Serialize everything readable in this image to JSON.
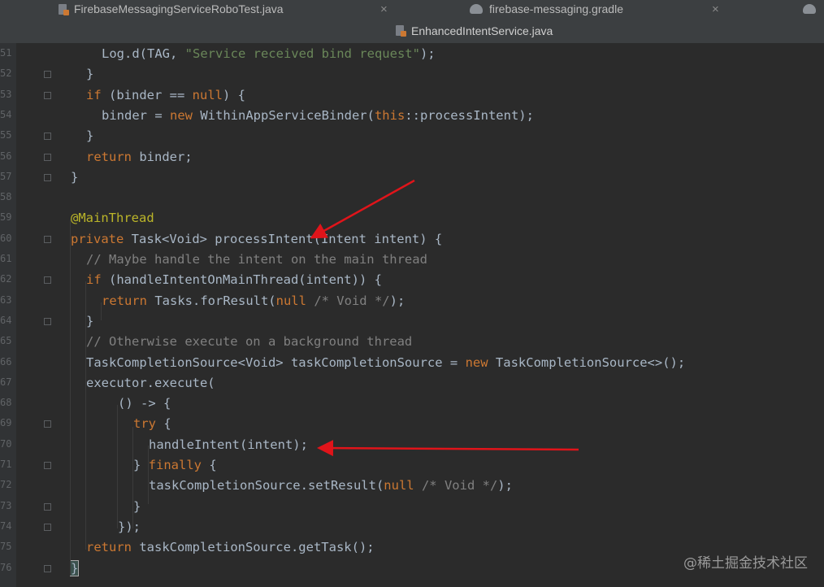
{
  "tabs_row1": [
    {
      "label": "FirebaseMessagingServiceRoboTest.java",
      "icon": "java-file-icon"
    },
    {
      "label": "firebase-messaging.gradle",
      "icon": "gradle-elephant-icon"
    }
  ],
  "active_tab": {
    "label": "EnhancedIntentService.java",
    "icon": "java-file-icon"
  },
  "line_numbers": [
    "51",
    "52",
    "53",
    "54",
    "55",
    "56",
    "57",
    "58",
    "59",
    "60",
    "61",
    "62",
    "63",
    "64",
    "65",
    "66",
    "67",
    "68",
    "69",
    "70",
    "71",
    "72",
    "73",
    "74",
    "75",
    "76"
  ],
  "code_lines": [
    {
      "indent": 125,
      "segments": [
        {
          "t": "Log.d(TAG, ",
          "c": ""
        },
        {
          "t": "\"Service received bind request\"",
          "c": "str"
        },
        {
          "t": ");",
          "c": ""
        }
      ]
    },
    {
      "indent": 106,
      "segments": [
        {
          "t": "}",
          "c": ""
        }
      ]
    },
    {
      "indent": 106,
      "segments": [
        {
          "t": "if",
          "c": "kw"
        },
        {
          "t": " (binder == ",
          "c": ""
        },
        {
          "t": "null",
          "c": "kw"
        },
        {
          "t": ") {",
          "c": ""
        }
      ]
    },
    {
      "indent": 125,
      "segments": [
        {
          "t": "binder = ",
          "c": ""
        },
        {
          "t": "new",
          "c": "kw"
        },
        {
          "t": " WithinAppServiceBinder(",
          "c": ""
        },
        {
          "t": "this",
          "c": "kw"
        },
        {
          "t": "::processIntent);",
          "c": ""
        }
      ]
    },
    {
      "indent": 106,
      "segments": [
        {
          "t": "}",
          "c": ""
        }
      ]
    },
    {
      "indent": 106,
      "segments": [
        {
          "t": "return",
          "c": "kw"
        },
        {
          "t": " binder;",
          "c": ""
        }
      ]
    },
    {
      "indent": 87,
      "segments": [
        {
          "t": "}",
          "c": ""
        }
      ]
    },
    {
      "indent": 87,
      "segments": []
    },
    {
      "indent": 87,
      "segments": [
        {
          "t": "@MainThread",
          "c": "ann"
        }
      ]
    },
    {
      "indent": 87,
      "segments": [
        {
          "t": "private",
          "c": "kw"
        },
        {
          "t": " Task<Void> processIntent(Intent intent) {",
          "c": ""
        }
      ]
    },
    {
      "indent": 106,
      "segments": [
        {
          "t": "// Maybe handle the intent on the main thread",
          "c": "cm"
        }
      ]
    },
    {
      "indent": 106,
      "segments": [
        {
          "t": "if",
          "c": "kw"
        },
        {
          "t": " (handleIntentOnMainThread(intent)) {",
          "c": ""
        }
      ]
    },
    {
      "indent": 125,
      "segments": [
        {
          "t": "return",
          "c": "kw"
        },
        {
          "t": " Tasks.forResult(",
          "c": ""
        },
        {
          "t": "null",
          "c": "kw"
        },
        {
          "t": " ",
          "c": ""
        },
        {
          "t": "/* Void */",
          "c": "cm"
        },
        {
          "t": ");",
          "c": ""
        }
      ]
    },
    {
      "indent": 106,
      "segments": [
        {
          "t": "}",
          "c": ""
        }
      ]
    },
    {
      "indent": 106,
      "segments": [
        {
          "t": "// Otherwise execute on a background thread",
          "c": "cm"
        }
      ]
    },
    {
      "indent": 106,
      "segments": [
        {
          "t": "TaskCompletionSource<Void> taskCompletionSource = ",
          "c": ""
        },
        {
          "t": "new",
          "c": "kw"
        },
        {
          "t": " TaskCompletionSource<>();",
          "c": ""
        }
      ]
    },
    {
      "indent": 106,
      "segments": [
        {
          "t": "executor.execute(",
          "c": ""
        }
      ]
    },
    {
      "indent": 145,
      "segments": [
        {
          "t": "() -> {",
          "c": ""
        }
      ]
    },
    {
      "indent": 164,
      "segments": [
        {
          "t": "try",
          "c": "kw"
        },
        {
          "t": " {",
          "c": ""
        }
      ]
    },
    {
      "indent": 183,
      "segments": [
        {
          "t": "handleIntent(intent);",
          "c": ""
        }
      ]
    },
    {
      "indent": 164,
      "segments": [
        {
          "t": "} ",
          "c": ""
        },
        {
          "t": "finally",
          "c": "kw"
        },
        {
          "t": " {",
          "c": ""
        }
      ]
    },
    {
      "indent": 183,
      "segments": [
        {
          "t": "taskCompletionSource.setResult(",
          "c": ""
        },
        {
          "t": "null",
          "c": "kw"
        },
        {
          "t": " ",
          "c": ""
        },
        {
          "t": "/* Void */",
          "c": "cm"
        },
        {
          "t": ");",
          "c": ""
        }
      ]
    },
    {
      "indent": 164,
      "segments": [
        {
          "t": "}",
          "c": ""
        }
      ]
    },
    {
      "indent": 145,
      "segments": [
        {
          "t": "});",
          "c": ""
        }
      ]
    },
    {
      "indent": 106,
      "segments": [
        {
          "t": "return",
          "c": "kw"
        },
        {
          "t": " taskCompletionSource.getTask();",
          "c": ""
        }
      ]
    },
    {
      "indent": 87,
      "segments": [
        {
          "t": "}",
          "c": ""
        }
      ]
    }
  ],
  "watermark": "@稀土掘金技术社区",
  "colors": {
    "background": "#2b2b2b",
    "keyword": "#cc7832",
    "string": "#6a8759",
    "comment": "#808080",
    "annotation": "#bbb529",
    "text": "#a9b7c6",
    "arrow": "#e0141a"
  }
}
